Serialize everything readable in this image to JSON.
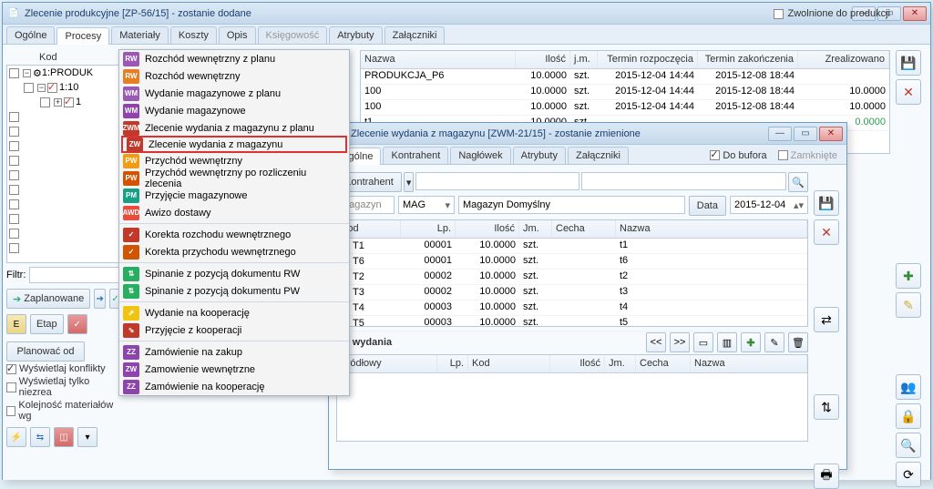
{
  "main": {
    "title": "Zlecenie produkcyjne  [ZP-56/15]  - zostanie dodane",
    "tabs": [
      "Ogólne",
      "Procesy",
      "Materiały",
      "Koszty",
      "Opis",
      "Księgowość",
      "Atrybuty",
      "Załączniki"
    ],
    "zwolnione": "Zwolnione do produkcji",
    "kod": "Kod",
    "tree": {
      "r0": "1:PRODUK",
      "r1": "1:10",
      "r2": "1"
    },
    "filtr_label": "Filtr:",
    "btns": {
      "zaplanowane": "Zaplanowane",
      "etap": "Etap",
      "planowac": "Planować od"
    },
    "chk": {
      "konflikty": "Wyświetlaj konflikty",
      "niezrea": "Wyświetlaj tylko niezrea",
      "kolej": "Kolejność materiałów wg"
    },
    "grid_hdr": {
      "nazwa": "Nazwa",
      "ilosc": "Ilość",
      "jm": "j.m.",
      "start": "Termin rozpoczęcia",
      "end": "Termin zakończenia",
      "zreal": "Zrealizowano"
    },
    "grid": [
      {
        "n": "PRODUKCJA_P6",
        "i": "10.0000",
        "j": "szt.",
        "s": "2015-12-04 14:44",
        "e": "2015-12-08 18:44",
        "z": ""
      },
      {
        "n": "100",
        "i": "10.0000",
        "j": "szt.",
        "s": "2015-12-04 14:44",
        "e": "2015-12-08 18:44",
        "z": "10.0000"
      },
      {
        "n": "100",
        "i": "10.0000",
        "j": "szt.",
        "s": "2015-12-04 14:44",
        "e": "2015-12-08 18:44",
        "z": "10.0000"
      },
      {
        "n": "t1",
        "i": "10.0000",
        "j": "szt.",
        "s": "",
        "e": "",
        "z": "0.0000"
      }
    ]
  },
  "menu": {
    "items": [
      {
        "ic": "RW",
        "c": "#9b59b6",
        "t": "Rozchód wewnętrzny z planu"
      },
      {
        "ic": "RW",
        "c": "#e67e22",
        "t": "Rozchód wewnętrzny"
      },
      {
        "ic": "WM",
        "c": "#9b59b6",
        "t": "Wydanie magazynowe z planu"
      },
      {
        "ic": "WM",
        "c": "#8e44ad",
        "t": "Wydanie magazynowe"
      },
      {
        "ic": "ZWM",
        "c": "#c0392b",
        "t": "Zlecenie wydania z magazynu z planu"
      },
      {
        "ic": "ZW",
        "c": "#c0392b",
        "t": "Zlecenie wydania z magazynu"
      },
      {
        "ic": "PW",
        "c": "#f39c12",
        "t": "Przychód wewnętrzny"
      },
      {
        "ic": "PW",
        "c": "#d35400",
        "t": "Przychód wewnętrzny po rozliczeniu zlecenia"
      },
      {
        "ic": "PM",
        "c": "#16a085",
        "t": "Przyjęcie magazynowe"
      },
      {
        "ic": "AWD",
        "c": "#e74c3c",
        "t": "Awizo dostawy"
      },
      {
        "ic": "✓",
        "c": "#c0392b",
        "t": "Korekta rozchodu wewnętrznego"
      },
      {
        "ic": "✓",
        "c": "#d35400",
        "t": "Korekta przychodu wewnętrznego"
      },
      {
        "ic": "⇅",
        "c": "#27ae60",
        "t": "Spinanie z pozycją dokumentu RW"
      },
      {
        "ic": "⇅",
        "c": "#27ae60",
        "t": "Spinanie z pozycją dokumentu PW"
      },
      {
        "ic": "⇗",
        "c": "#f1c40f",
        "t": "Wydanie na kooperację"
      },
      {
        "ic": "⇘",
        "c": "#c0392b",
        "t": "Przyjęcie z kooperacji"
      },
      {
        "ic": "ZZ",
        "c": "#8e44ad",
        "t": "Zamówienie na zakup"
      },
      {
        "ic": "ZW",
        "c": "#8e44ad",
        "t": "Zamowienie wewnętrzne"
      },
      {
        "ic": "ZZ",
        "c": "#8e44ad",
        "t": "Zamówienie na kooperację"
      }
    ]
  },
  "w2": {
    "title": "Zlecenie wydania z magazynu [ZWM-21/15]  - zostanie zmienione",
    "tabs": [
      "Ogólne",
      "Kontrahent",
      "Nagłówek",
      "Atrybuty",
      "Załączniki"
    ],
    "do_bufora": "Do bufora",
    "zamkniete": "Zamknięte",
    "kontrahent_btn": "Kontrahent",
    "magazyn_lbl": "Magazyn",
    "mag_val": "MAG",
    "mag_desc": "Magazyn Domyślny",
    "data_btn": "Data",
    "data_val": "2015-12-04",
    "ghdr": {
      "kod": "Kod",
      "lp": "Lp.",
      "ilosc": "Ilość",
      "jm": "Jm.",
      "cecha": "Cecha",
      "nazwa": "Nazwa"
    },
    "rows": [
      {
        "k": "T1",
        "l": "00001",
        "i": "10.0000",
        "j": "szt.",
        "n": "t1"
      },
      {
        "k": "T6",
        "l": "00001",
        "i": "10.0000",
        "j": "szt.",
        "n": "t6"
      },
      {
        "k": "T2",
        "l": "00002",
        "i": "10.0000",
        "j": "szt.",
        "n": "t2"
      },
      {
        "k": "T3",
        "l": "00002",
        "i": "10.0000",
        "j": "szt.",
        "n": "t3"
      },
      {
        "k": "T4",
        "l": "00003",
        "i": "10.0000",
        "j": "szt.",
        "n": "t4"
      },
      {
        "k": "T5",
        "l": "00003",
        "i": "10.0000",
        "j": "szt.",
        "n": "t5"
      }
    ],
    "do_wydania": "Do wydania",
    "ghdr2": {
      "src": "Źródłowy",
      "lp": "Lp.",
      "kod": "Kod",
      "ilosc": "Ilość",
      "jm": "Jm.",
      "cecha": "Cecha",
      "nazwa": "Nazwa"
    },
    "nav": {
      "prev": "<<",
      "next": ">>"
    }
  }
}
